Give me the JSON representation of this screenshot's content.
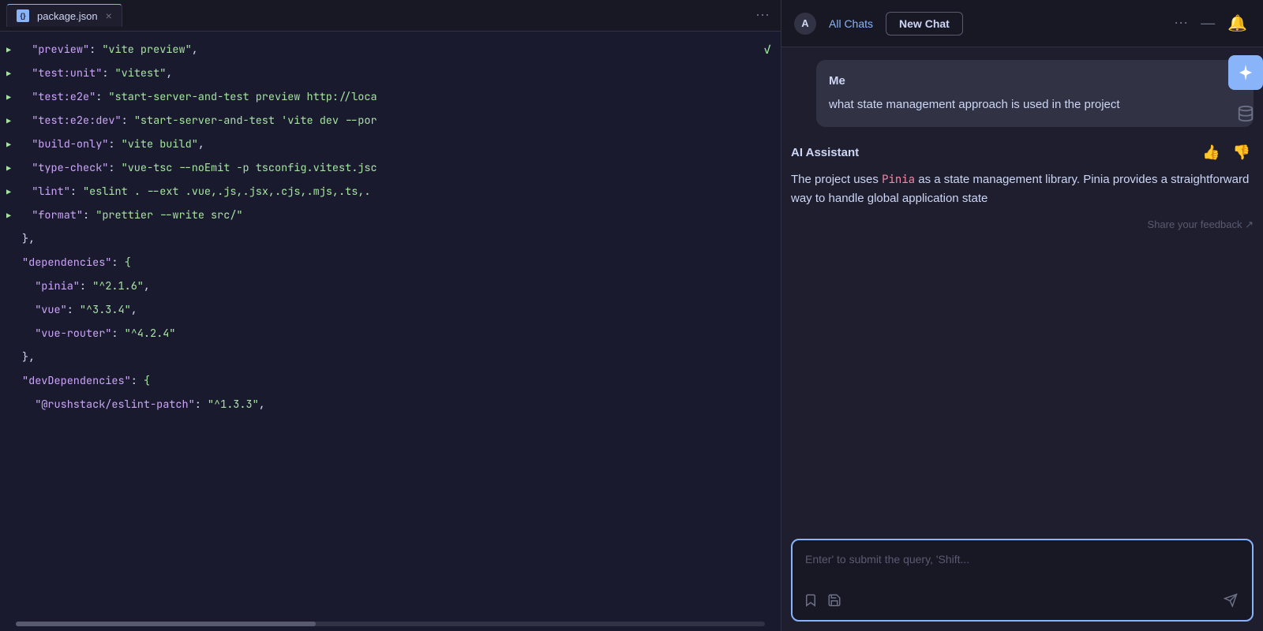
{
  "editor": {
    "tab_label": "package.json",
    "tab_icon": "{}",
    "lines": [
      {
        "id": 1,
        "has_run": true,
        "content": "  \"preview\": \"vite preview\",",
        "has_check": true
      },
      {
        "id": 2,
        "has_run": true,
        "content": "  \"test:unit\": \"vitest\","
      },
      {
        "id": 3,
        "has_run": true,
        "content": "  \"test:e2e\": \"start-server-and-test preview http://loca"
      },
      {
        "id": 4,
        "has_run": true,
        "content": "  \"test:e2e:dev\": \"start-server-and-test 'vite dev --por"
      },
      {
        "id": 5,
        "has_run": true,
        "content": "  \"build-only\": \"vite build\","
      },
      {
        "id": 6,
        "has_run": true,
        "content": "  \"type-check\": \"vue-tsc --noEmit -p tsconfig.vitest.jsc"
      },
      {
        "id": 7,
        "has_run": true,
        "content": "  \"lint\": \"eslint . --ext .vue,.js,.jsx,.cjs,.mjs,.ts,."
      },
      {
        "id": 8,
        "has_run": true,
        "content": "  \"format\": \"prettier --write src/\""
      },
      {
        "id": 9,
        "has_run": false,
        "content": "},"
      },
      {
        "id": 10,
        "has_run": false,
        "content": "\"dependencies\": {"
      },
      {
        "id": 11,
        "has_run": false,
        "content": "  \"pinia\": \"^2.1.6\","
      },
      {
        "id": 12,
        "has_run": false,
        "content": "  \"vue\": \"^3.3.4\","
      },
      {
        "id": 13,
        "has_run": false,
        "content": "  \"vue-router\": \"^4.2.4\""
      },
      {
        "id": 14,
        "has_run": false,
        "content": "},"
      },
      {
        "id": 15,
        "has_run": false,
        "content": "\"devDependencies\": {"
      },
      {
        "id": 16,
        "has_run": false,
        "content": "  \"@rushstack/eslint-patch\": \"^1.3.3\","
      }
    ]
  },
  "header": {
    "all_chats_label": "All Chats",
    "new_chat_label": "New Chat"
  },
  "user_message": {
    "name": "Me",
    "text": "what state management approach is used in the project"
  },
  "ai_message": {
    "name": "AI Assistant",
    "text": "The project uses Pinia as a state management library. Pinia provides a straightforward way to handle global application state",
    "feedback_link": "Share your feedback ↗"
  },
  "input": {
    "placeholder": "Enter' to submit the query, 'Shift..."
  },
  "icons": {
    "sparkle": "✦",
    "db": "🗄",
    "send": "➤",
    "thumbup": "👍",
    "thumbdown": "👎",
    "bookmark": "🔖",
    "save": "💾",
    "bell": "🔔",
    "minus": "—",
    "more": "⋯"
  }
}
